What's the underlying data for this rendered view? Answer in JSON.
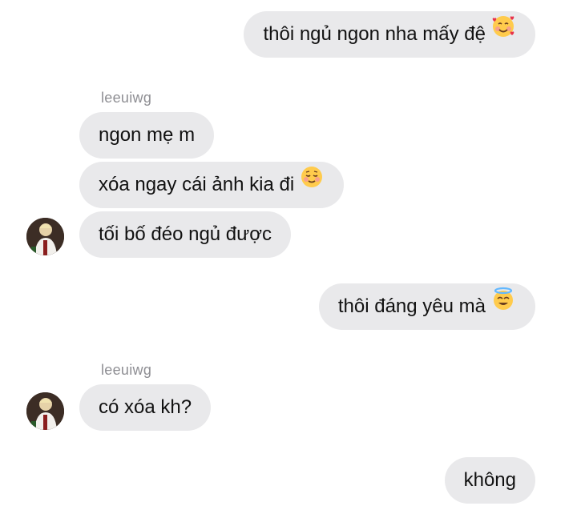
{
  "messages": [
    {
      "side": "right",
      "text": "thôi ngủ ngon nha mấy đệ",
      "emoji": "smiling-face-with-hearts-icon"
    },
    {
      "side": "left",
      "text": "ngon mẹ m"
    },
    {
      "side": "left",
      "text": "xóa ngay cái ảnh kia đi",
      "emoji": "relieved-smiling-face-icon"
    },
    {
      "side": "left",
      "text": "tối bố đéo ngủ được"
    },
    {
      "side": "right",
      "text": "thôi đáng yêu mà",
      "emoji": "smiling-face-with-halo-icon"
    },
    {
      "side": "left",
      "text": "có xóa kh?"
    },
    {
      "side": "right",
      "text": "không"
    }
  ],
  "senders": [
    "leeuiwg",
    "leeuiwg"
  ],
  "colors": {
    "bubble": "#e9e9eb",
    "text": "#111111",
    "sender": "#8e8e93",
    "background": "#ffffff"
  }
}
